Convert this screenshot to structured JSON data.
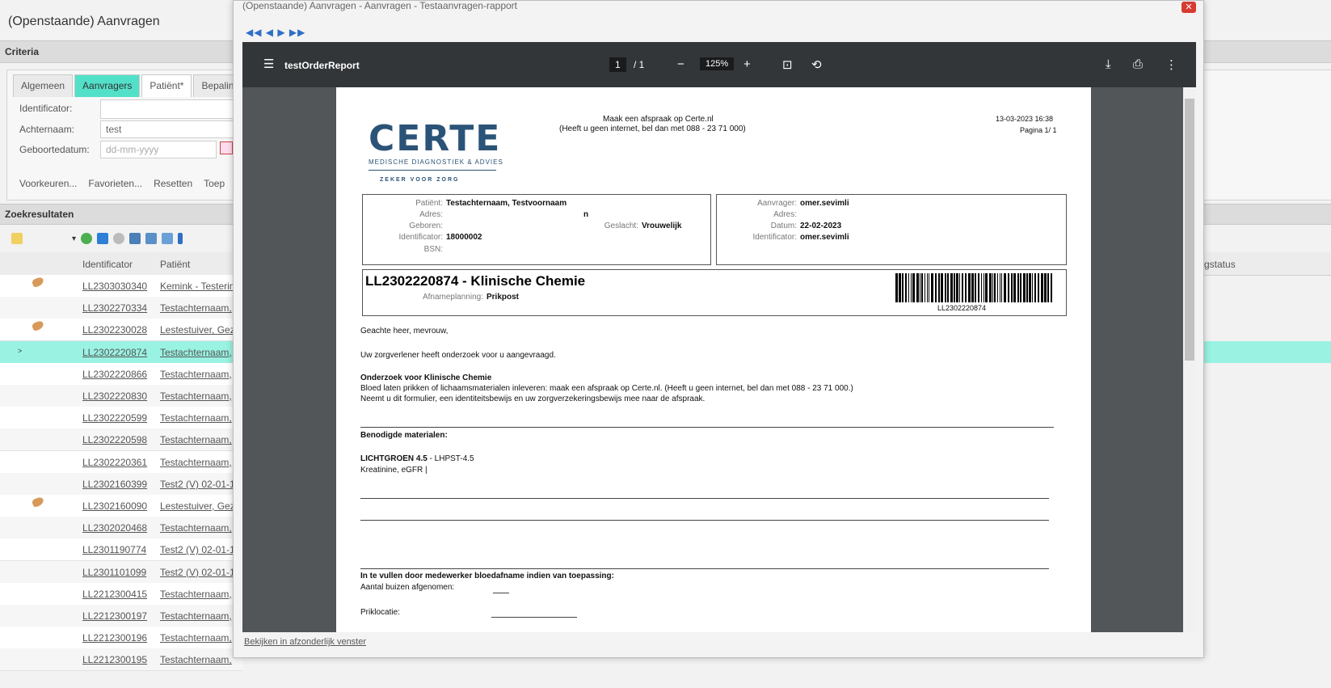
{
  "app": {
    "title": "(Openstaande) Aanvragen",
    "criteria_label": "Criteria",
    "tabs": [
      "Algemeen",
      "Aanvragers",
      "Patiënt*",
      "Bepalinge"
    ],
    "fields": {
      "identificator_label": "Identificator:",
      "achternaam_label": "Achternaam:",
      "achternaam_value": "test",
      "geboortedatum_label": "Geboortedatum:",
      "geboortedatum_placeholder": "dd-mm-yyyy"
    },
    "actions": [
      "Voorkeuren...",
      "Favorieten...",
      "Resetten",
      "Toep"
    ],
    "results_label": "Zoekresultaten",
    "columns": {
      "identificator": "Identificator",
      "patient": "Patiënt",
      "status": "gstatus"
    },
    "rows": [
      {
        "id": "LL2303030340",
        "patient": "Kemink - Testerin",
        "tag": true
      },
      {
        "id": "LL2302270334",
        "patient": "Testachternaam,",
        "tag": false
      },
      {
        "id": "LL2302230028",
        "patient": "Lestestuiver, Gez",
        "tag": true
      },
      {
        "id": "LL2302220874",
        "patient": "Testachternaam,",
        "tag": false,
        "selected": true
      },
      {
        "id": "LL2302220866",
        "patient": "Testachternaam,",
        "tag": false
      },
      {
        "id": "LL2302220830",
        "patient": "Testachternaam,",
        "tag": false
      },
      {
        "id": "LL2302220599",
        "patient": "Testachternaam,",
        "tag": false
      },
      {
        "id": "LL2302220598",
        "patient": "Testachternaam,",
        "tag": false
      },
      {
        "id": "LL2302220361",
        "patient": "Testachternaam,",
        "tag": false
      },
      {
        "id": "LL2302160399",
        "patient": "Test2 (V) 02-01-1",
        "tag": false
      },
      {
        "id": "LL2302160090",
        "patient": "Lestestuiver, Gez",
        "tag": true
      },
      {
        "id": "LL2302020468",
        "patient": "Testachternaam,",
        "tag": false
      },
      {
        "id": "LL2301190774",
        "patient": "Test2 (V) 02-01-1",
        "tag": false
      },
      {
        "id": "LL2301101099",
        "patient": "Test2 (V) 02-01-1",
        "tag": false
      },
      {
        "id": "LL2212300415",
        "patient": "Testachternaam,",
        "tag": false
      },
      {
        "id": "LL2212300197",
        "patient": "Testachternaam,",
        "tag": false
      },
      {
        "id": "LL2212300196",
        "patient": "Testachternaam,",
        "tag": false
      },
      {
        "id": "LL2212300195",
        "patient": "Testachternaam,",
        "tag": false
      }
    ]
  },
  "modal": {
    "title": "(Openstaande) Aanvragen - Aanvragen - Testaanvragen-rapport",
    "nav": "◀◀ ◀ ▶ ▶▶",
    "footer_link": "Bekijken in afzonderlijk venster",
    "pdf": {
      "doc_title": "testOrderReport",
      "page_current": "1",
      "page_total": "/ 1",
      "zoom": "125%"
    }
  },
  "report": {
    "logo_text": "CERTE",
    "logo_sub1": "MEDISCHE DIAGNOSTIEK & ADVIES",
    "logo_sub2": "ZEKER VOOR ZORG",
    "header_line1": "Maak een afspraak op Certe.nl",
    "header_line2": "(Heeft u geen internet, bel dan met 088 - 23 71 000)",
    "date": "13-03-2023 16:38",
    "page": "Pagina 1/ 1",
    "patient": {
      "label": "Patiënt:",
      "value": "Testachternaam, Testvoornaam",
      "adres_label": "Adres:",
      "adres_value": "n",
      "geboren_label": "Geboren:",
      "geslacht_label": "Geslacht:",
      "geslacht_value": "Vrouwelijk",
      "identificator_label": "Identificator:",
      "identificator_value": "18000002",
      "bsn_label": "BSN:"
    },
    "requester": {
      "aanvrager_label": "Aanvrager:",
      "aanvrager_value": "omer.sevimli",
      "adres_label": "Adres:",
      "datum_label": "Datum:",
      "datum_value": "22-02-2023",
      "identificator_label": "Identificator:",
      "identificator_value": "omer.sevimli"
    },
    "order_title": "LL2302220874 - Klinische Chemie",
    "afname_label": "Afnameplanning:",
    "afname_value": "Prikpost",
    "barcode_text": "LL2302220874",
    "greeting": "Geachte heer, mevrouw,",
    "intro": "Uw zorgverlener heeft onderzoek voor u aangevraagd.",
    "section_title": "Onderzoek voor Klinische Chemie",
    "section_line1": "Bloed laten prikken of lichaamsmaterialen inleveren: maak een afspraak op Certe.nl. (Heeft u geen internet, bel dan met 088 - 23 71 000.)",
    "section_line2": "Neemt u dit formulier, een identiteitsbewijs en uw zorgverzekeringsbewijs mee naar de afspraak.",
    "materials_title": "Benodigde materialen:",
    "material_name": "LICHTGROEN 4.5",
    "material_code": " - LHPST-4.5",
    "material_tests": "Kreatinine, eGFR |",
    "staff_title": "In te vullen door medewerker bloedafname indien van toepassing:",
    "tubes_label": "Aantal buizen afgenomen:",
    "location_label": "Priklocatie:"
  }
}
